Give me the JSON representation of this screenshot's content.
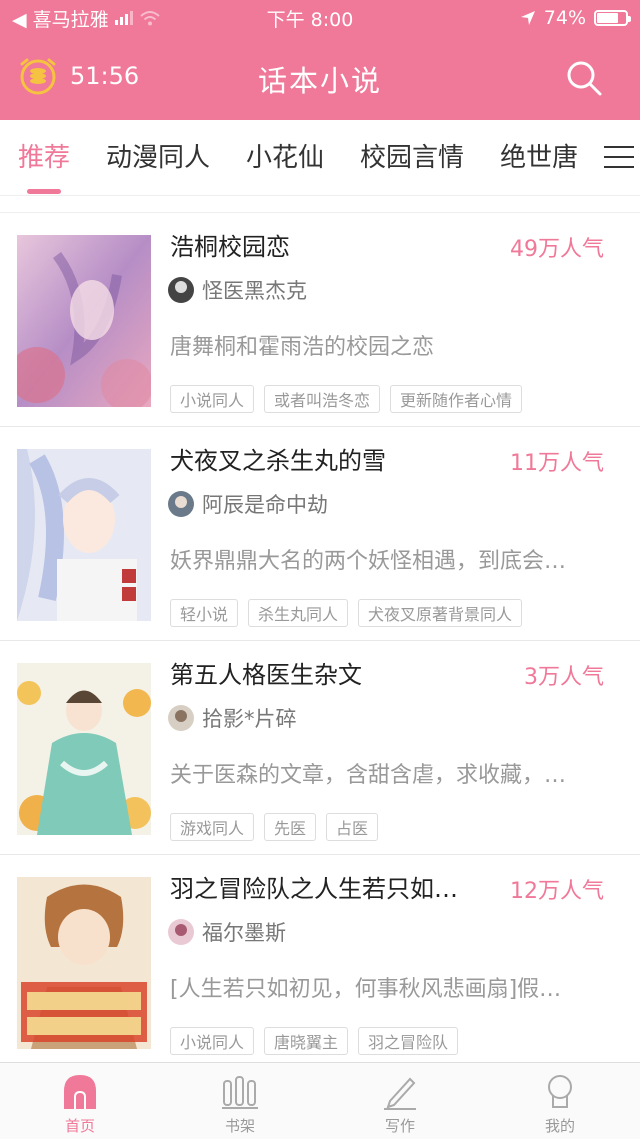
{
  "status_bar": {
    "carrier": "◀ 喜马拉雅",
    "time": "下午 8:00",
    "battery": "74%",
    "battery_level": 0.74
  },
  "header": {
    "timer": "51:56",
    "title": "话本小说",
    "search_icon": "search-icon"
  },
  "tabs": [
    {
      "label": "推荐",
      "active": true
    },
    {
      "label": "动漫同人"
    },
    {
      "label": "小花仙"
    },
    {
      "label": "校园言情"
    },
    {
      "label": "绝世唐"
    }
  ],
  "books": [
    {
      "title": "浩桐校园恋",
      "popularity": "49万人气",
      "author": "怪医黑杰克",
      "desc": "唐舞桐和霍雨浩的校园之恋",
      "tags": [
        "小说同人",
        "或者叫浩冬恋",
        "更新随作者心情"
      ]
    },
    {
      "title": "犬夜叉之杀生丸的雪",
      "popularity": "11万人气",
      "author": "阿辰是命中劫",
      "desc": "妖界鼎鼎大名的两个妖怪相遇，到底会…",
      "tags": [
        "轻小说",
        "杀生丸同人",
        "犬夜叉原著背景同人"
      ]
    },
    {
      "title": "第五人格医生杂文",
      "popularity": "3万人气",
      "author": "拾影*片碎",
      "desc": "关于医森的文章，含甜含虐，求收藏，…",
      "tags": [
        "游戏同人",
        "先医",
        "占医"
      ]
    },
    {
      "title": "羽之冒险队之人生若只如…",
      "popularity": "12万人气",
      "author": "福尔墨斯",
      "desc": "[人生若只如初见，何事秋风悲画扇]假…",
      "tags": [
        "小说同人",
        "唐晓翼主",
        "羽之冒险队"
      ]
    }
  ],
  "bottom_nav": [
    {
      "label": "首页",
      "icon": "home-icon",
      "active": true
    },
    {
      "label": "书架",
      "icon": "bookshelf-icon"
    },
    {
      "label": "写作",
      "icon": "pen-icon"
    },
    {
      "label": "我的",
      "icon": "profile-icon"
    }
  ],
  "colors": {
    "brand": "#f07898",
    "text": "#333333",
    "muted": "#999999"
  }
}
